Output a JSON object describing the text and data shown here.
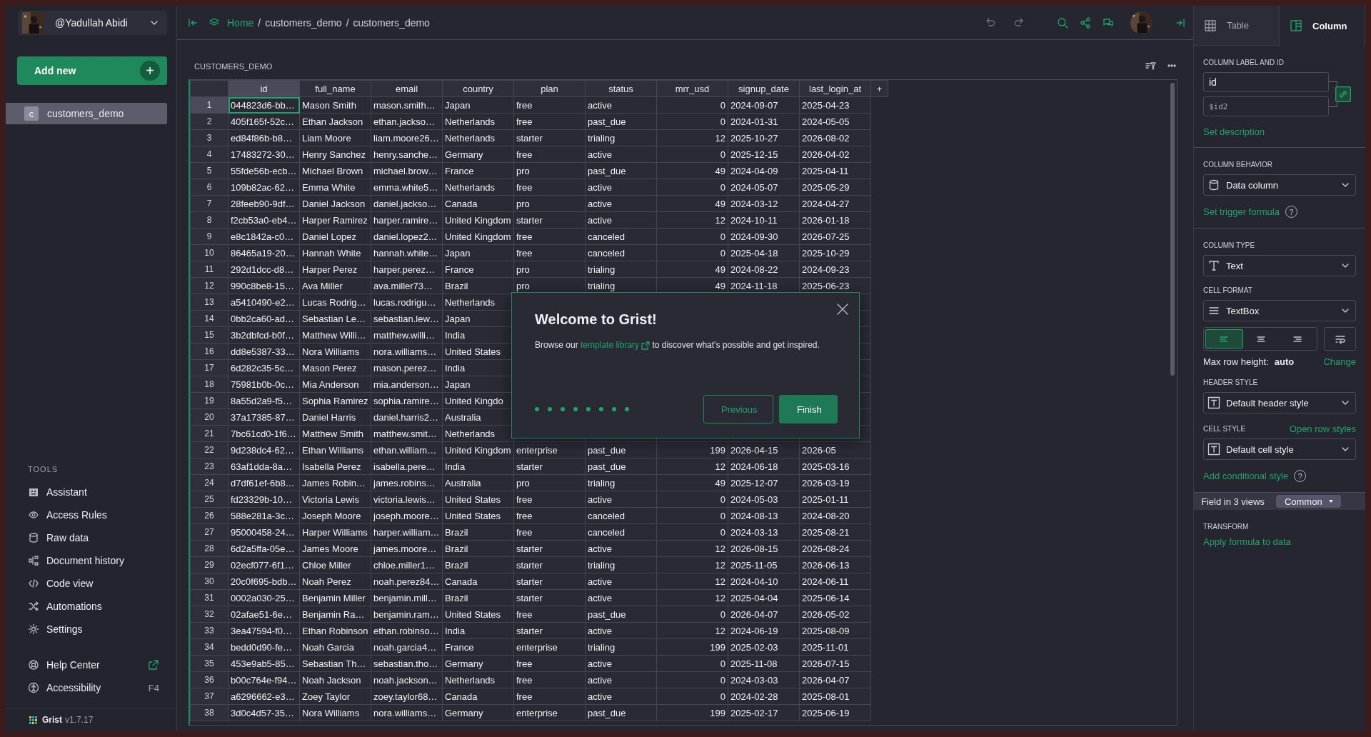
{
  "account": {
    "name": "@Yadullah Abidi"
  },
  "add_new": {
    "label": "Add new",
    "plus": "+"
  },
  "pages": [
    {
      "letter": "c",
      "label": "customers_demo",
      "selected": true
    }
  ],
  "tools": {
    "heading": "TOOLS",
    "items": [
      {
        "label": "Assistant"
      },
      {
        "label": "Access Rules"
      },
      {
        "label": "Raw data"
      },
      {
        "label": "Document history"
      },
      {
        "label": "Code view"
      },
      {
        "label": "Automations"
      },
      {
        "label": "Settings"
      }
    ]
  },
  "help": [
    {
      "label": "Help Center",
      "kind": "external"
    },
    {
      "label": "Accessibility",
      "kind": "shortcut",
      "shortcut": "F4"
    }
  ],
  "footer": {
    "brand": "Grist",
    "version": "v1.7.17"
  },
  "breadcrumb": {
    "items": [
      "Home",
      "customers_demo",
      "customers_demo"
    ],
    "separator": "/"
  },
  "section_title": "CUSTOMERS_DEMO",
  "table": {
    "columns": [
      {
        "label": "id",
        "kind": "text",
        "selected": true
      },
      {
        "label": "full_name",
        "kind": "text",
        "selected": false
      },
      {
        "label": "email",
        "kind": "text",
        "selected": false
      },
      {
        "label": "country",
        "kind": "text",
        "selected": false
      },
      {
        "label": "plan",
        "kind": "text",
        "selected": false
      },
      {
        "label": "status",
        "kind": "text",
        "selected": false
      },
      {
        "label": "mrr_usd",
        "kind": "number",
        "selected": false
      },
      {
        "label": "signup_date",
        "kind": "text",
        "selected": false
      },
      {
        "label": "last_login_at",
        "kind": "text",
        "selected": false
      }
    ],
    "add_column": "+",
    "rows": [
      {
        "n": "1",
        "selected": true,
        "cells": [
          "044823d6-bb…",
          "Mason Smith",
          "mason.smith…",
          "Japan",
          "free",
          "active",
          "0",
          "2024-09-07",
          "2025-04-23"
        ]
      },
      {
        "n": "2",
        "selected": false,
        "cells": [
          "405f165f-52c…",
          "Ethan Jackson",
          "ethan.jackso…",
          "Netherlands",
          "free",
          "past_due",
          "0",
          "2024-01-31",
          "2024-05-05"
        ]
      },
      {
        "n": "3",
        "selected": false,
        "cells": [
          "ed84f86b-b8…",
          "Liam Moore",
          "liam.moore26…",
          "Netherlands",
          "starter",
          "trialing",
          "12",
          "2025-10-27",
          "2026-08-02"
        ]
      },
      {
        "n": "4",
        "selected": false,
        "cells": [
          "17483272-30…",
          "Henry Sanchez",
          "henry.sanche…",
          "Germany",
          "free",
          "active",
          "0",
          "2025-12-15",
          "2026-04-02"
        ]
      },
      {
        "n": "5",
        "selected": false,
        "cells": [
          "55fde56b-ecb…",
          "Michael Brown",
          "michael.brow…",
          "France",
          "pro",
          "past_due",
          "49",
          "2024-04-09",
          "2025-04-11"
        ]
      },
      {
        "n": "6",
        "selected": false,
        "cells": [
          "109b82ac-62…",
          "Emma White",
          "emma.white5…",
          "Netherlands",
          "free",
          "active",
          "0",
          "2024-05-07",
          "2025-05-29"
        ]
      },
      {
        "n": "7",
        "selected": false,
        "cells": [
          "28feeb90-9df…",
          "Daniel Jackson",
          "daniel.jackso…",
          "Canada",
          "pro",
          "active",
          "49",
          "2024-03-12",
          "2024-04-27"
        ]
      },
      {
        "n": "8",
        "selected": false,
        "cells": [
          "f2cb53a0-eb4…",
          "Harper Ramirez",
          "harper.ramire…",
          "United Kingdom",
          "starter",
          "active",
          "12",
          "2024-10-11",
          "2026-01-18"
        ]
      },
      {
        "n": "9",
        "selected": false,
        "cells": [
          "e8c1842a-c0…",
          "Daniel Lopez",
          "daniel.lopez2…",
          "United Kingdom",
          "free",
          "canceled",
          "0",
          "2024-09-30",
          "2026-07-25"
        ]
      },
      {
        "n": "10",
        "selected": false,
        "cells": [
          "86465a19-20…",
          "Hannah White",
          "hannah.white…",
          "Japan",
          "free",
          "canceled",
          "0",
          "2025-04-18",
          "2025-10-29"
        ]
      },
      {
        "n": "11",
        "selected": false,
        "cells": [
          "292d1dcc-d8…",
          "Harper Perez",
          "harper.perez…",
          "France",
          "pro",
          "trialing",
          "49",
          "2024-08-22",
          "2024-09-23"
        ]
      },
      {
        "n": "12",
        "selected": false,
        "cells": [
          "990c8be8-15…",
          "Ava Miller",
          "ava.miller73…",
          "Brazil",
          "pro",
          "trialing",
          "49",
          "2024-11-18",
          "2025-06-23"
        ]
      },
      {
        "n": "13",
        "selected": false,
        "cells": [
          "a5410490-e2…",
          "Lucas Rodrig…",
          "lucas.rodrigu…",
          "Netherlands",
          null,
          null,
          null,
          null,
          null
        ]
      },
      {
        "n": "14",
        "selected": false,
        "cells": [
          "0bb2ca60-ad…",
          "Sebastian Le…",
          "sebastian.lew…",
          "Japan",
          null,
          null,
          null,
          null,
          null
        ]
      },
      {
        "n": "15",
        "selected": false,
        "cells": [
          "3b2dbfcd-b0f…",
          "Matthew Willi…",
          "matthew.willi…",
          "India",
          null,
          null,
          null,
          null,
          null
        ]
      },
      {
        "n": "16",
        "selected": false,
        "cells": [
          "dd8e5387-33…",
          "Nora Williams",
          "nora.williams…",
          "United States",
          null,
          null,
          null,
          null,
          null
        ]
      },
      {
        "n": "17",
        "selected": false,
        "cells": [
          "6d282c35-5c…",
          "Mason Perez",
          "mason.perez…",
          "India",
          null,
          null,
          null,
          null,
          null
        ]
      },
      {
        "n": "18",
        "selected": false,
        "cells": [
          "75981b0b-0c…",
          "Mia Anderson",
          "mia.anderson…",
          "Japan",
          null,
          null,
          null,
          null,
          null
        ]
      },
      {
        "n": "19",
        "selected": false,
        "cells": [
          "8a55d2a9-f5…",
          "Sophia Ramirez",
          "sophia.ramire…",
          "United Kingdo",
          null,
          null,
          null,
          null,
          null
        ]
      },
      {
        "n": "20",
        "selected": false,
        "cells": [
          "37a17385-87…",
          "Daniel Harris",
          "daniel.harris2…",
          "Australia",
          null,
          null,
          null,
          null,
          null
        ]
      },
      {
        "n": "21",
        "selected": false,
        "cells": [
          "7bc61cd0-1f6…",
          "Matthew Smith",
          "matthew.smit…",
          "Netherlands",
          null,
          null,
          null,
          null,
          null
        ]
      },
      {
        "n": "22",
        "selected": false,
        "cells": [
          "9d238dc4-62…",
          "Ethan Williams",
          "ethan.william…",
          "United Kingdom",
          "enterprise",
          "past_due",
          "199",
          "2026-04-15",
          "2026-05"
        ]
      },
      {
        "n": "23",
        "selected": false,
        "cells": [
          "63af1dda-8a…",
          "Isabella Perez",
          "isabella.pere…",
          "India",
          "starter",
          "past_due",
          "12",
          "2024-06-18",
          "2025-03-16"
        ]
      },
      {
        "n": "24",
        "selected": false,
        "cells": [
          "d7df61ef-6b8…",
          "James Robin…",
          "james.robins…",
          "Australia",
          "pro",
          "trialing",
          "49",
          "2025-12-07",
          "2026-03-19"
        ]
      },
      {
        "n": "25",
        "selected": false,
        "cells": [
          "fd23329b-10…",
          "Victoria Lewis",
          "victoria.lewis…",
          "United States",
          "free",
          "active",
          "0",
          "2024-05-03",
          "2025-01-11"
        ]
      },
      {
        "n": "26",
        "selected": false,
        "cells": [
          "588e281a-3c…",
          "Joseph Moore",
          "joseph.moore…",
          "United States",
          "free",
          "canceled",
          "0",
          "2024-08-13",
          "2024-08-20"
        ]
      },
      {
        "n": "27",
        "selected": false,
        "cells": [
          "95000458-24…",
          "Harper Williams",
          "harper.william…",
          "Brazil",
          "free",
          "canceled",
          "0",
          "2024-03-13",
          "2025-08-21"
        ]
      },
      {
        "n": "28",
        "selected": false,
        "cells": [
          "6d2a5ffa-05e…",
          "James Moore",
          "james.moore…",
          "Brazil",
          "starter",
          "active",
          "12",
          "2026-08-15",
          "2026-08-24"
        ]
      },
      {
        "n": "29",
        "selected": false,
        "cells": [
          "02ecf077-6f1…",
          "Chloe Miller",
          "chloe.miller1…",
          "Brazil",
          "starter",
          "trialing",
          "12",
          "2025-11-05",
          "2026-06-13"
        ]
      },
      {
        "n": "30",
        "selected": false,
        "cells": [
          "20c0f695-bdb…",
          "Noah Perez",
          "noah.perez84…",
          "Canada",
          "starter",
          "active",
          "12",
          "2024-04-10",
          "2024-06-11"
        ]
      },
      {
        "n": "31",
        "selected": false,
        "cells": [
          "0002a030-25…",
          "Benjamin Miller",
          "benjamin.mill…",
          "Brazil",
          "starter",
          "active",
          "12",
          "2025-04-04",
          "2025-06-14"
        ]
      },
      {
        "n": "32",
        "selected": false,
        "cells": [
          "02afae51-6e…",
          "Benjamin Ra…",
          "benjamin.ram…",
          "United States",
          "free",
          "past_due",
          "0",
          "2026-04-07",
          "2026-05-02"
        ]
      },
      {
        "n": "33",
        "selected": false,
        "cells": [
          "3ea47594-f0…",
          "Ethan Robinson",
          "ethan.robinso…",
          "India",
          "starter",
          "active",
          "12",
          "2024-06-19",
          "2025-08-09"
        ]
      },
      {
        "n": "34",
        "selected": false,
        "cells": [
          "bedd0d90-fe…",
          "Noah Garcia",
          "noah.garcia4…",
          "France",
          "enterprise",
          "trialing",
          "199",
          "2025-02-03",
          "2025-11-01"
        ]
      },
      {
        "n": "35",
        "selected": false,
        "cells": [
          "453e9ab5-85…",
          "Sebastian Th…",
          "sebastian.tho…",
          "Germany",
          "free",
          "active",
          "0",
          "2025-11-08",
          "2026-07-15"
        ]
      },
      {
        "n": "36",
        "selected": false,
        "cells": [
          "b00c764e-f94…",
          "Noah Jackson",
          "noah.jackson…",
          "Netherlands",
          "free",
          "active",
          "0",
          "2024-03-03",
          "2026-04-07"
        ]
      },
      {
        "n": "37",
        "selected": false,
        "cells": [
          "a6296662-e3…",
          "Zoey Taylor",
          "zoey.taylor68…",
          "Canada",
          "free",
          "active",
          "0",
          "2024-02-28",
          "2025-08-01"
        ]
      },
      {
        "n": "38",
        "selected": false,
        "cells": [
          "3d0c4d57-35…",
          "Nora Williams",
          "nora.williams…",
          "Germany",
          "enterprise",
          "past_due",
          "199",
          "2025-02-17",
          "2025-06-19"
        ]
      }
    ]
  },
  "dialog": {
    "title": "Welcome to Grist!",
    "text_before": "Browse our",
    "link": "template library",
    "text_after": "to discover what's possible and get inspired.",
    "dots": [
      {
        "done": true
      },
      {
        "done": true
      },
      {
        "done": true
      },
      {
        "done": true
      },
      {
        "done": true
      },
      {
        "done": true
      },
      {
        "done": true
      },
      {
        "done": true
      }
    ],
    "buttons": [
      {
        "label": "Previous",
        "kind": "secondary"
      },
      {
        "label": "Finish",
        "kind": "primary"
      }
    ]
  },
  "right_panel": {
    "tabs": [
      {
        "label": "Table",
        "selected": false
      },
      {
        "label": "Column",
        "selected": true
      }
    ],
    "label_section": {
      "heading": "COLUMN LABEL AND ID",
      "label": "id",
      "col_id": "$id2",
      "link": "Set description"
    },
    "behavior": {
      "heading": "COLUMN BEHAVIOR",
      "value": "Data column",
      "link": "Set trigger formula",
      "help": "?"
    },
    "type": {
      "heading": "COLUMN TYPE",
      "value": "Text"
    },
    "format": {
      "heading": "CELL FORMAT",
      "value": "TextBox",
      "alignments": [
        {
          "selected": true
        },
        {
          "selected": false
        },
        {
          "selected": false
        }
      ],
      "wrap": false,
      "max_label": "Max row height:",
      "max_value": "auto",
      "change": "Change"
    },
    "header_style": {
      "heading": "HEADER STYLE",
      "value": "Default header style"
    },
    "cell_style": {
      "heading": "CELL STYLE",
      "link": "Open row styles",
      "value": "Default cell style",
      "conditional": "Add conditional style",
      "help": "?"
    },
    "field": {
      "label": "Field in 3 views",
      "value": "Common"
    },
    "transform": {
      "heading": "TRANSFORM",
      "link": "Apply formula to data"
    }
  }
}
